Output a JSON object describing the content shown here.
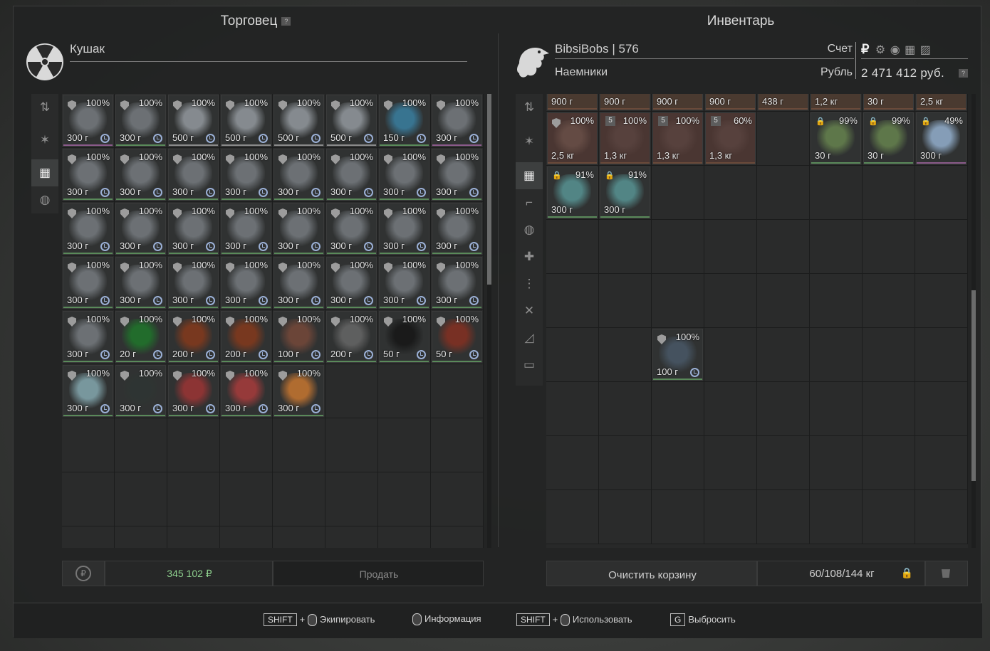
{
  "trader": {
    "title": "Торговец",
    "help": "?",
    "name": "Кушак",
    "sum": "345 102 ₽",
    "sell_label": "Продать",
    "rows": [
      [
        {
          "p": "100%",
          "v": "300 г",
          "c": "#7b8085"
        },
        {
          "p": "100%",
          "v": "300 г",
          "c": "#7b8085"
        },
        {
          "p": "100%",
          "v": "500 г",
          "c": "#9aa0a6"
        },
        {
          "p": "100%",
          "v": "500 г",
          "c": "#9aa0a6"
        },
        {
          "p": "100%",
          "v": "500 г",
          "c": "#9aa0a6"
        },
        {
          "p": "100%",
          "v": "500 г",
          "c": "#9aa0a6"
        },
        {
          "p": "100%",
          "v": "150 г",
          "c": "#3a84a8"
        },
        {
          "p": "100%",
          "v": "300 г",
          "c": "#7b8085"
        }
      ],
      [
        {
          "p": "100%",
          "v": "300 г",
          "c": "#7b8085"
        },
        {
          "p": "100%",
          "v": "300 г",
          "c": "#7b8085"
        },
        {
          "p": "100%",
          "v": "300 г",
          "c": "#7b8085"
        },
        {
          "p": "100%",
          "v": "300 г",
          "c": "#7b8085"
        },
        {
          "p": "100%",
          "v": "300 г",
          "c": "#7b8085"
        },
        {
          "p": "100%",
          "v": "300 г",
          "c": "#7b8085"
        },
        {
          "p": "100%",
          "v": "300 г",
          "c": "#7b8085"
        },
        {
          "p": "100%",
          "v": "300 г",
          "c": "#7b8085"
        }
      ],
      [
        {
          "p": "100%",
          "v": "300 г",
          "c": "#7b8085"
        },
        {
          "p": "100%",
          "v": "300 г",
          "c": "#7b8085"
        },
        {
          "p": "100%",
          "v": "300 г",
          "c": "#7b8085"
        },
        {
          "p": "100%",
          "v": "300 г",
          "c": "#7b8085"
        },
        {
          "p": "100%",
          "v": "300 г",
          "c": "#7b8085"
        },
        {
          "p": "100%",
          "v": "300 г",
          "c": "#7b8085"
        },
        {
          "p": "100%",
          "v": "300 г",
          "c": "#7b8085"
        },
        {
          "p": "100%",
          "v": "300 г",
          "c": "#7b8085"
        }
      ],
      [
        {
          "p": "100%",
          "v": "300 г",
          "c": "#7b8085"
        },
        {
          "p": "100%",
          "v": "300 г",
          "c": "#7b8085"
        },
        {
          "p": "100%",
          "v": "300 г",
          "c": "#7b8085"
        },
        {
          "p": "100%",
          "v": "300 г",
          "c": "#7b8085"
        },
        {
          "p": "100%",
          "v": "300 г",
          "c": "#7b8085"
        },
        {
          "p": "100%",
          "v": "300 г",
          "c": "#7b8085"
        },
        {
          "p": "100%",
          "v": "300 г",
          "c": "#7b8085"
        },
        {
          "p": "100%",
          "v": "300 г",
          "c": "#7b8085"
        }
      ],
      [
        {
          "p": "100%",
          "v": "300 г",
          "c": "#7b8085"
        },
        {
          "p": "100%",
          "v": "20 г",
          "c": "#1e7a2a"
        },
        {
          "p": "100%",
          "v": "200 г",
          "c": "#8a3a1a"
        },
        {
          "p": "100%",
          "v": "200 г",
          "c": "#8a3a1a"
        },
        {
          "p": "100%",
          "v": "100 г",
          "c": "#7a4a3a"
        },
        {
          "p": "100%",
          "v": "200 г",
          "c": "#6a6a6a"
        },
        {
          "p": "100%",
          "v": "50 г",
          "c": "#141414"
        },
        {
          "p": "100%",
          "v": "50 г",
          "c": "#8a3020"
        }
      ],
      [
        {
          "p": "100%",
          "v": "300 г",
          "c": "#8ab0b8"
        },
        {
          "p": "100%",
          "v": "300 г",
          "c": "#2e3533"
        },
        {
          "p": "100%",
          "v": "300 г",
          "c": "#a33434"
        },
        {
          "p": "100%",
          "v": "300 г",
          "c": "#b03c3c"
        },
        {
          "p": "100%",
          "v": "300 г",
          "c": "#d07a30"
        }
      ]
    ]
  },
  "inventory": {
    "title": "Инвентарь",
    "player": "BibsiBobs",
    "sep": "|",
    "level": "576",
    "faction": "Наемники",
    "account_label": "Счет",
    "currency_label": "Рубль",
    "currency_symbol": "₽",
    "money": "2 471 412 руб.",
    "help": "?",
    "top_row": [
      "900 г",
      "900 г",
      "900 г",
      "900 г",
      "438 г",
      "1,2 кг",
      "30 г",
      "2,5 кг"
    ],
    "row1": [
      {
        "p": "100%",
        "v": "2,5 кг",
        "c": "#6a5048",
        "badge": ""
      },
      {
        "p": "100%",
        "v": "1,3 кг",
        "c": "#5a4440",
        "badge": "5"
      },
      {
        "p": "100%",
        "v": "1,3 кг",
        "c": "#5a4440",
        "badge": "5"
      },
      {
        "p": "60%",
        "v": "1,3 кг",
        "c": "#5a4440",
        "badge": "5"
      },
      null,
      {
        "p": "99%",
        "v": "30 г",
        "c": "#6a8850",
        "lock": true
      },
      {
        "p": "99%",
        "v": "30 г",
        "c": "#6a8850",
        "lock": true
      },
      {
        "p": "49%",
        "v": "300 г",
        "c": "#9ab8d8",
        "lock": true
      }
    ],
    "row2": [
      {
        "p": "91%",
        "v": "300 г",
        "c": "#5a9a9a",
        "lock": true
      },
      {
        "p": "91%",
        "v": "300 г",
        "c": "#5a9a9a",
        "lock": true
      }
    ],
    "single": {
      "p": "100%",
      "v": "100 г",
      "c": "#4a5a6a"
    },
    "clear_label": "Очистить корзину",
    "weight": "60/108/144 кг"
  },
  "footer": {
    "shift": "SHIFT",
    "plus": "+",
    "equip": "Экипировать",
    "info": "Информация",
    "use": "Использовать",
    "g": "G",
    "drop": "Выбросить"
  }
}
